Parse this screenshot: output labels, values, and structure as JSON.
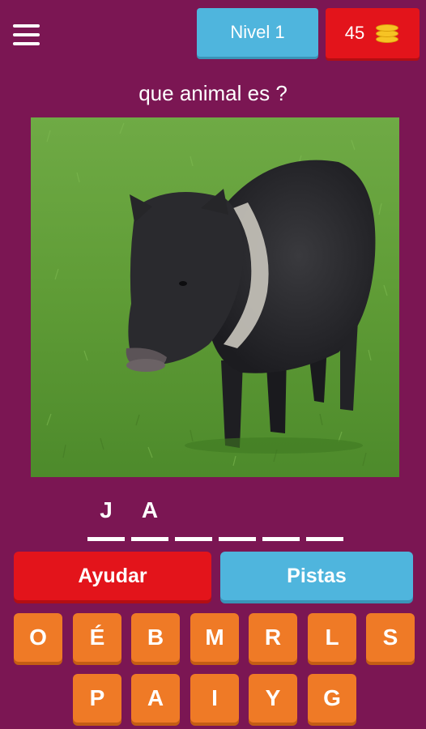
{
  "header": {
    "menu_icon": "hamburger-menu-icon",
    "level_label": "Nivel 1",
    "coins": "45",
    "coin_icon": "coin-stack-icon"
  },
  "question": "que animal es ?",
  "image": {
    "subject": "peccary-photo"
  },
  "answer": {
    "slots": [
      "J",
      "A",
      "",
      "",
      "",
      ""
    ]
  },
  "actions": {
    "help_label": "Ayudar",
    "hints_label": "Pistas"
  },
  "keyboard": {
    "row1": [
      "O",
      "É",
      "B",
      "M",
      "R",
      "L",
      "S"
    ],
    "row2": [
      "P",
      "A",
      "I",
      "Y",
      "G"
    ]
  },
  "colors": {
    "background": "#7b1653",
    "red": "#e3141b",
    "blue": "#4fb5dd",
    "orange": "#ef7a26"
  }
}
